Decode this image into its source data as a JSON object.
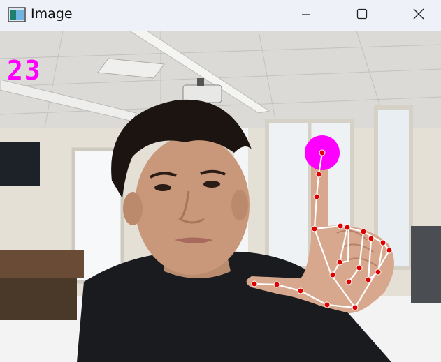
{
  "window": {
    "title": "Image",
    "icon": "image-viewer-icon",
    "controls": {
      "minimize": "minimize-icon",
      "maximize": "maximize-icon",
      "close": "close-icon"
    }
  },
  "overlay": {
    "fps_counter": "23",
    "fps_color": "#ff00ff",
    "landmark_color": "#e00000",
    "connection_color": "#ffffff",
    "fingertip_marker_color": "#ff00ff"
  }
}
